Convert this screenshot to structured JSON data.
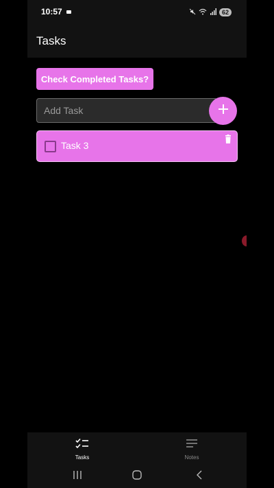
{
  "status_bar": {
    "time": "10:57",
    "battery": "62",
    "icons": [
      "camera-icon",
      "mute-icon",
      "wifi-icon",
      "signal-icon",
      "battery-icon"
    ]
  },
  "app_bar": {
    "title": "Tasks"
  },
  "actions": {
    "check_completed_label": "Check Completed Tasks?",
    "add_task_placeholder": "Add Task",
    "add_task_value": ""
  },
  "tasks": [
    {
      "label": "Task 3",
      "completed": false
    }
  ],
  "bottom_nav": {
    "items": [
      {
        "label": "Tasks",
        "icon": "checklist-icon",
        "active": true
      },
      {
        "label": "Notes",
        "icon": "notes-icon",
        "active": false
      }
    ]
  },
  "colors": {
    "accent": "#e774e9",
    "background": "#000000",
    "surface": "#121212"
  }
}
